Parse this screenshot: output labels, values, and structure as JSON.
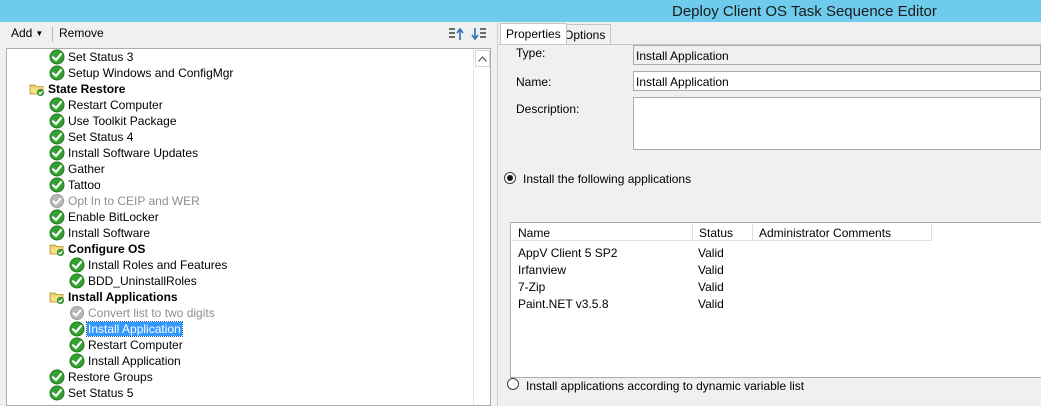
{
  "window": {
    "title": "Deploy Client OS Task Sequence Editor"
  },
  "toolbar": {
    "add_label": "Add",
    "remove_label": "Remove"
  },
  "tree": {
    "items": [
      {
        "label": "Set Status 3",
        "icon": "green-check-icon",
        "state": "step"
      },
      {
        "label": "Setup Windows and ConfigMgr",
        "icon": "green-check-icon",
        "state": "step"
      },
      {
        "label": "State Restore",
        "icon": "folder-icon",
        "state": "group"
      },
      {
        "label": "Restart Computer",
        "icon": "green-check-icon",
        "state": "step"
      },
      {
        "label": "Use Toolkit Package",
        "icon": "green-check-icon",
        "state": "step"
      },
      {
        "label": "Set Status 4",
        "icon": "green-check-icon",
        "state": "step"
      },
      {
        "label": "Install Software Updates",
        "icon": "green-check-icon",
        "state": "step"
      },
      {
        "label": "Gather",
        "icon": "green-check-icon",
        "state": "step"
      },
      {
        "label": "Tattoo",
        "icon": "green-check-icon",
        "state": "step"
      },
      {
        "label": "Opt In to CEIP and WER",
        "icon": "grey-check-icon",
        "state": "disabled"
      },
      {
        "label": "Enable BitLocker",
        "icon": "green-check-icon",
        "state": "step"
      },
      {
        "label": "Install Software",
        "icon": "green-check-icon",
        "state": "step"
      },
      {
        "label": "Configure OS",
        "icon": "folder-icon",
        "state": "group"
      },
      {
        "label": "Install Roles and Features",
        "icon": "green-check-icon",
        "state": "step"
      },
      {
        "label": "BDD_UninstallRoles",
        "icon": "green-check-icon",
        "state": "step"
      },
      {
        "label": "Install Applications",
        "icon": "folder-icon",
        "state": "group"
      },
      {
        "label": "Convert list to two digits",
        "icon": "grey-check-icon",
        "state": "disabled"
      },
      {
        "label": "Install Application",
        "icon": "green-check-icon",
        "state": "selected"
      },
      {
        "label": "Restart Computer",
        "icon": "green-check-icon",
        "state": "step"
      },
      {
        "label": "Install Application",
        "icon": "green-check-icon",
        "state": "step"
      },
      {
        "label": "Restore Groups",
        "icon": "green-check-icon",
        "state": "step"
      },
      {
        "label": "Set Status 5",
        "icon": "green-check-icon",
        "state": "step"
      }
    ]
  },
  "tabs": [
    {
      "label": "Properties",
      "active": true
    },
    {
      "label": "Options",
      "active": false
    }
  ],
  "properties": {
    "type_label": "Type:",
    "type_value": "Install Application",
    "name_label": "Name:",
    "name_value": "Install Application",
    "description_label": "Description:",
    "description_value": "",
    "radio_following": "Install the following applications",
    "radio_dynamic": "Install applications according to dynamic variable list",
    "selected_option": "following"
  },
  "app_list": {
    "columns": [
      "Name",
      "Status",
      "Administrator Comments"
    ],
    "rows": [
      {
        "name": "AppV Client 5 SP2",
        "status": "Valid",
        "comments": ""
      },
      {
        "name": "Irfanview",
        "status": "Valid",
        "comments": ""
      },
      {
        "name": "7-Zip",
        "status": "Valid",
        "comments": ""
      },
      {
        "name": "Paint.NET v3.5.8",
        "status": "Valid",
        "comments": ""
      }
    ]
  },
  "colors": {
    "titlebar": "#6ecbec",
    "selection": "#3399ff",
    "check_green": "#35a12f"
  }
}
